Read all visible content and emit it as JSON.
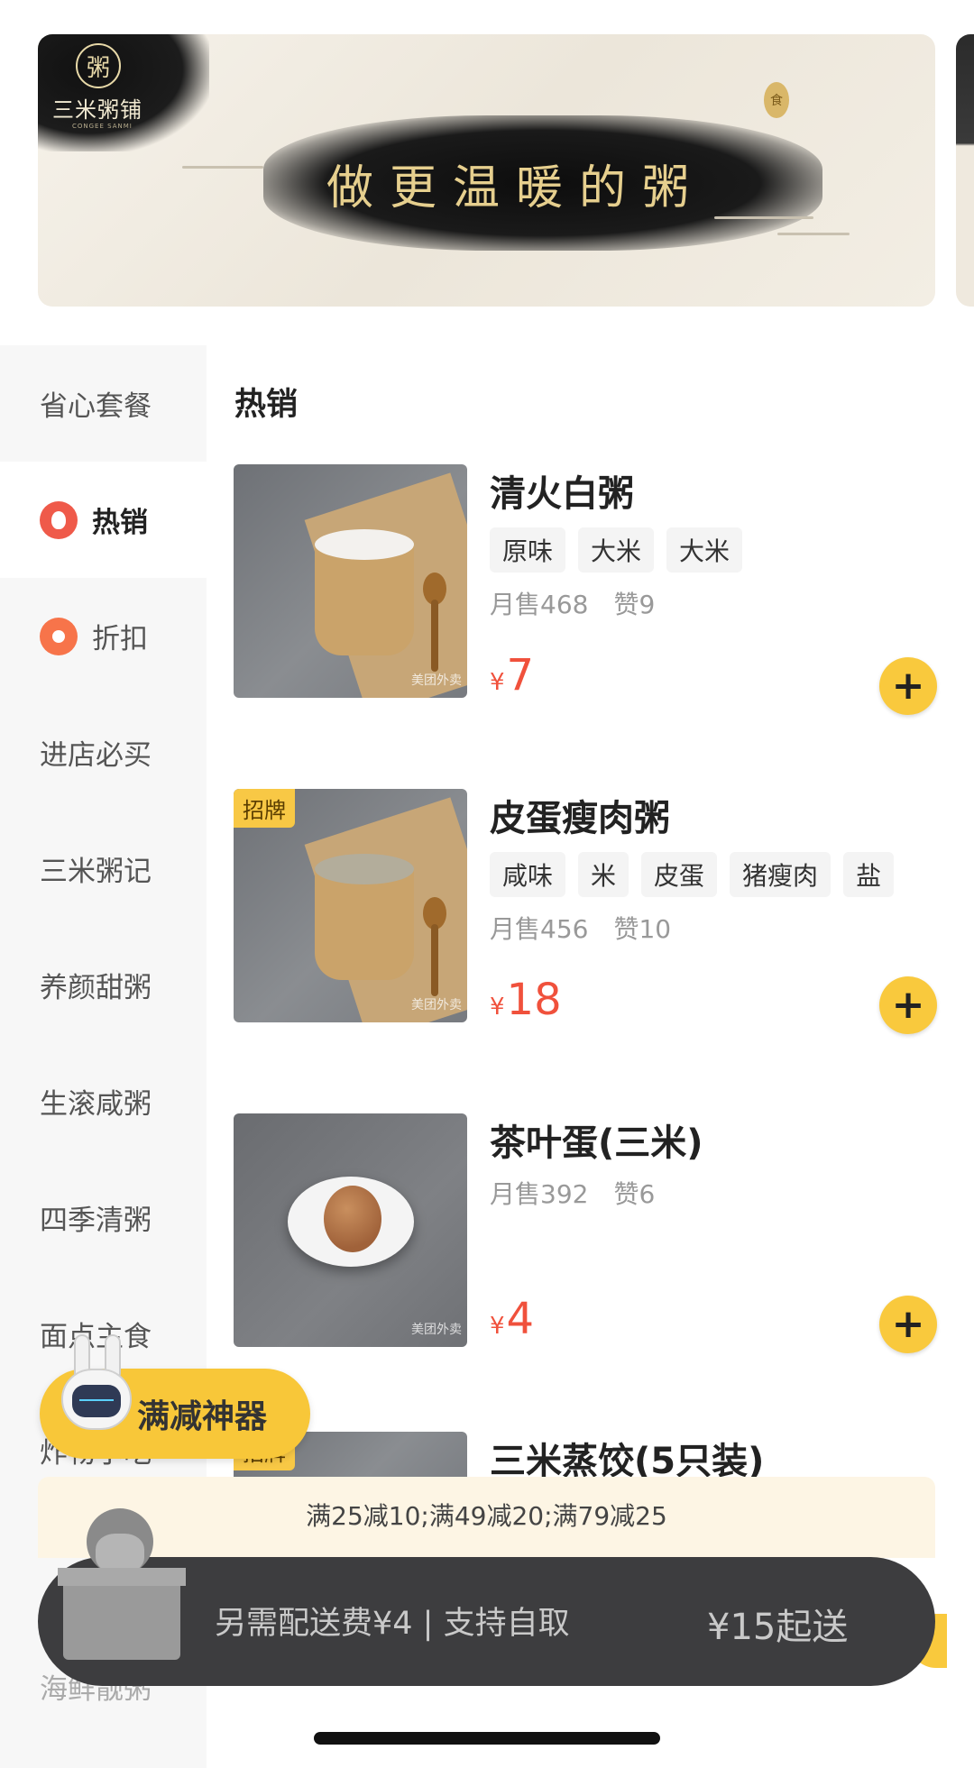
{
  "banner": {
    "brand": "三米粥铺",
    "brand_en": "CONGEE SANMI",
    "logo_char": "粥",
    "slogan": "做更温暖的粥",
    "seal_char": "食"
  },
  "sidebar": {
    "items": [
      {
        "label": "省心套餐",
        "icon": ""
      },
      {
        "label": "热销",
        "icon": "flame-icon"
      },
      {
        "label": "折扣",
        "icon": "discount-tag-icon"
      },
      {
        "label": "进店必买",
        "icon": ""
      },
      {
        "label": "三米粥记",
        "icon": ""
      },
      {
        "label": "养颜甜粥",
        "icon": ""
      },
      {
        "label": "生滚咸粥",
        "icon": ""
      },
      {
        "label": "四季清粥",
        "icon": ""
      },
      {
        "label": "面点主食",
        "icon": ""
      },
      {
        "label": "炸物小吃",
        "icon": ""
      },
      {
        "label": "海鲜靓粥",
        "icon": ""
      }
    ],
    "active_index": 1
  },
  "section_title": "热销",
  "products": [
    {
      "name": "清火白粥",
      "tags": [
        "原味",
        "大米",
        "大米"
      ],
      "monthly_sales": "月售468",
      "likes": "赞9",
      "currency": "¥",
      "price": "7",
      "badge": "",
      "watermark": "美团外卖"
    },
    {
      "name": "皮蛋瘦肉粥",
      "tags": [
        "咸味",
        "米",
        "皮蛋",
        "猪瘦肉",
        "盐"
      ],
      "monthly_sales": "月售456",
      "likes": "赞10",
      "currency": "¥",
      "price": "18",
      "badge": "招牌",
      "watermark": "美团外卖"
    },
    {
      "name": "茶叶蛋(三米)",
      "tags": [],
      "monthly_sales": "月售392",
      "likes": "赞6",
      "currency": "¥",
      "price": "4",
      "badge": "",
      "watermark": "美团外卖"
    },
    {
      "name": "三米蒸饺(5只装)",
      "badge": "招牌"
    }
  ],
  "add_button_glyph": "+",
  "promo": {
    "label": "满减神器"
  },
  "discount_strip": "满25减10;满49减20;满79减25",
  "cart": {
    "delivery_info": "另需配送费¥4 | 支持自取",
    "minimum": "¥15起送"
  },
  "colors": {
    "accent": "#f9c93d",
    "price": "#f0513c",
    "cart_bar": "#3d3d3f"
  }
}
